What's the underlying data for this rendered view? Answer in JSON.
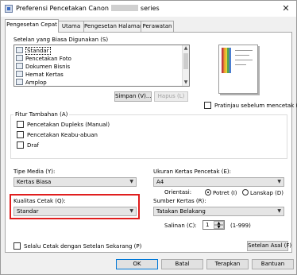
{
  "window": {
    "title_prefix": "Preferensi Pencetakan Canon",
    "title_suffix": "series",
    "close_glyph": "✕",
    "app_icon": "printer-icon"
  },
  "tabs": [
    {
      "label": "Pengesetan Cepat",
      "active": true
    },
    {
      "label": "Utama",
      "active": false
    },
    {
      "label": "Pengesetan Halaman",
      "active": false
    },
    {
      "label": "Perawatan",
      "active": false
    }
  ],
  "common_settings": {
    "label": "Setelan yang Biasa Digunakan (S)",
    "items": [
      {
        "label": "Standar",
        "selected": true,
        "icon": "document-icon"
      },
      {
        "label": "Pencetakan Foto",
        "selected": false,
        "icon": "photo-icon"
      },
      {
        "label": "Dokumen Bisnis",
        "selected": false,
        "icon": "document-icon"
      },
      {
        "label": "Hemat Kertas",
        "selected": false,
        "icon": "paper-save-icon"
      },
      {
        "label": "Amplop",
        "selected": false,
        "icon": "envelope-icon"
      }
    ],
    "save_button": "Simpan (V)...",
    "delete_button": "Hapus (L)"
  },
  "preview": {
    "checkbox_label": "Pratinjau sebelum mencetak (W)",
    "checked": false
  },
  "additional_features": {
    "label": "Fitur Tambahan (A)",
    "options": [
      {
        "label": "Pencetakan Dupleks (Manual)",
        "checked": false
      },
      {
        "label": "Pencetakan Keabu-abuan",
        "checked": false
      },
      {
        "label": "Draf",
        "checked": false
      }
    ]
  },
  "media_type": {
    "label": "Tipe Media (Y):",
    "value": "Kertas Biasa"
  },
  "print_quality": {
    "label": "Kualitas Cetak (Q):",
    "value": "Standar"
  },
  "page_size": {
    "label": "Ukuran Kertas Pencetak (E):",
    "value": "A4"
  },
  "orientation": {
    "label": "Orientasi:",
    "portrait": "Potret (I)",
    "landscape": "Lanskap (D)",
    "selected": "portrait"
  },
  "paper_source": {
    "label": "Sumber Kertas (R):",
    "value": "Tatakan Belakang"
  },
  "copies": {
    "label": "Salinan (C):",
    "value": "1",
    "range": "(1-999)"
  },
  "always_print": {
    "label": "Selalu Cetak dengan Setelan Sekarang (P)",
    "checked": false
  },
  "defaults_button": "Setelan Asal (F)",
  "footer": {
    "ok": "OK",
    "cancel": "Batal",
    "apply": "Terapkan",
    "help": "Bantuan"
  },
  "colors": {
    "highlight": "#e01e1e",
    "accent": "#0078d7"
  }
}
